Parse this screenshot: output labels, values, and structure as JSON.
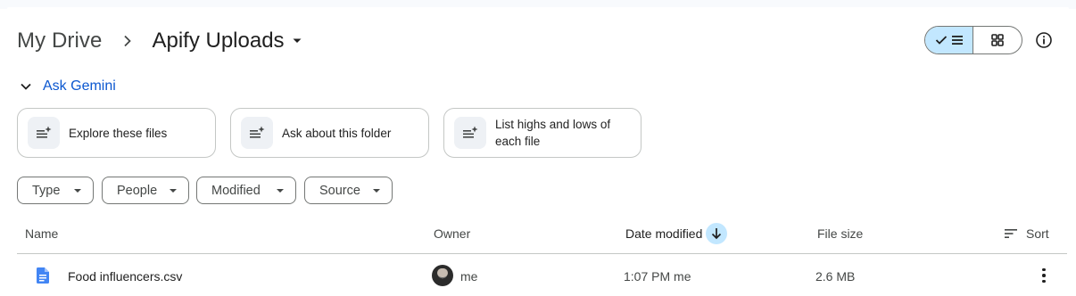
{
  "breadcrumb": {
    "root": "My Drive",
    "current": "Apify Uploads"
  },
  "gemini": {
    "label": "Ask Gemini",
    "suggestions": [
      "Explore these files",
      "Ask about this folder",
      "List highs and lows of each file"
    ]
  },
  "filters": [
    "Type",
    "People",
    "Modified",
    "Source"
  ],
  "table": {
    "columns": {
      "name": "Name",
      "owner": "Owner",
      "date_modified": "Date modified",
      "file_size": "File size",
      "sort": "Sort"
    },
    "rows": [
      {
        "name": "Food influencers.csv",
        "owner": "me",
        "modified": "1:07 PM me",
        "size": "2.6 MB",
        "icon": "google-doc-icon"
      }
    ]
  },
  "colors": {
    "accent": "#0b57d0",
    "selected_bg": "#c2e7ff",
    "doc_icon": "#4285f4"
  },
  "view_mode": "list"
}
